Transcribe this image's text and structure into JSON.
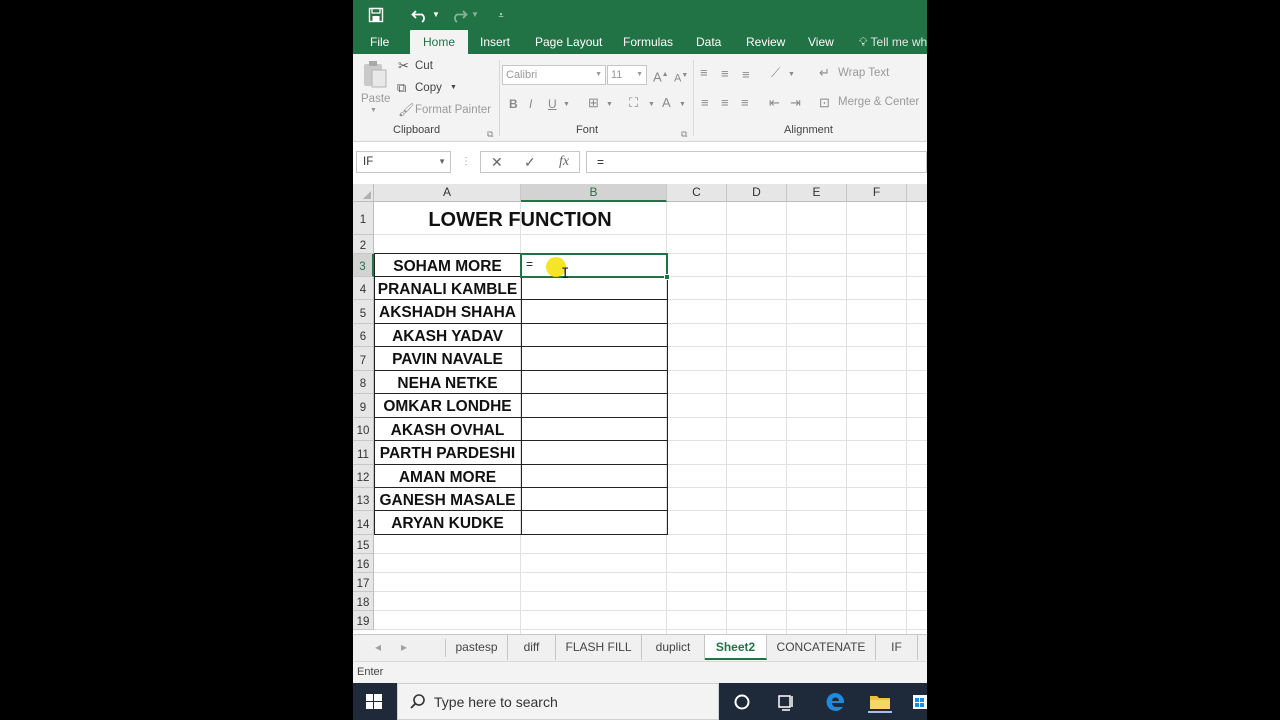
{
  "qat": {
    "save_icon": "save-icon",
    "undo_icon": "undo-icon",
    "redo_icon": "redo-icon",
    "customize_icon": "customize-qat-icon"
  },
  "tabs": [
    "File",
    "Home",
    "Insert",
    "Page Layout",
    "Formulas",
    "Data",
    "Review",
    "View"
  ],
  "tell_me": "Tell me wh",
  "ribbon": {
    "clipboard": {
      "paste": "Paste",
      "cut": "Cut",
      "copy": "Copy",
      "format_painter": "Format Painter",
      "label": "Clipboard"
    },
    "font": {
      "name": "Calibri",
      "size": "11",
      "bold": "B",
      "italic": "I",
      "underline": "U",
      "label": "Font"
    },
    "alignment": {
      "wrap_text": "Wrap Text",
      "merge_center": "Merge & Center",
      "label": "Alignment"
    }
  },
  "formula_bar": {
    "name_box": "IF",
    "cancel": "✕",
    "enter": "✓",
    "fx": "fx",
    "content": "="
  },
  "columns": [
    "A",
    "B",
    "C",
    "D",
    "E",
    "F"
  ],
  "rows": [
    "1",
    "2",
    "3",
    "4",
    "5",
    "6",
    "7",
    "8",
    "9",
    "10",
    "11",
    "12",
    "13",
    "14",
    "15",
    "16",
    "17",
    "18",
    "19"
  ],
  "sheet": {
    "title": "LOWER FUNCTION",
    "names": [
      "SOHAM MORE",
      "PRANALI KAMBLE",
      "AKSHADH SHAHA",
      "AKASH YADAV",
      "PAVIN NAVALE",
      "NEHA NETKE",
      "OMKAR LONDHE",
      "AKASH OVHAL",
      "PARTH PARDESHI",
      "AMAN MORE",
      "GANESH MASALE",
      "ARYAN KUDKE"
    ],
    "editing_value": "=",
    "active_cell": "B3"
  },
  "sheet_tabs": [
    "pastesp",
    "diff",
    "FLASH FILL",
    "duplict",
    "Sheet2",
    "CONCATENATE",
    "IF"
  ],
  "active_sheet": "Sheet2",
  "status": "Enter",
  "taskbar": {
    "search_placeholder": "Type here to search"
  },
  "colors": {
    "excel_green": "#217346",
    "taskbar": "#1e2a39"
  }
}
